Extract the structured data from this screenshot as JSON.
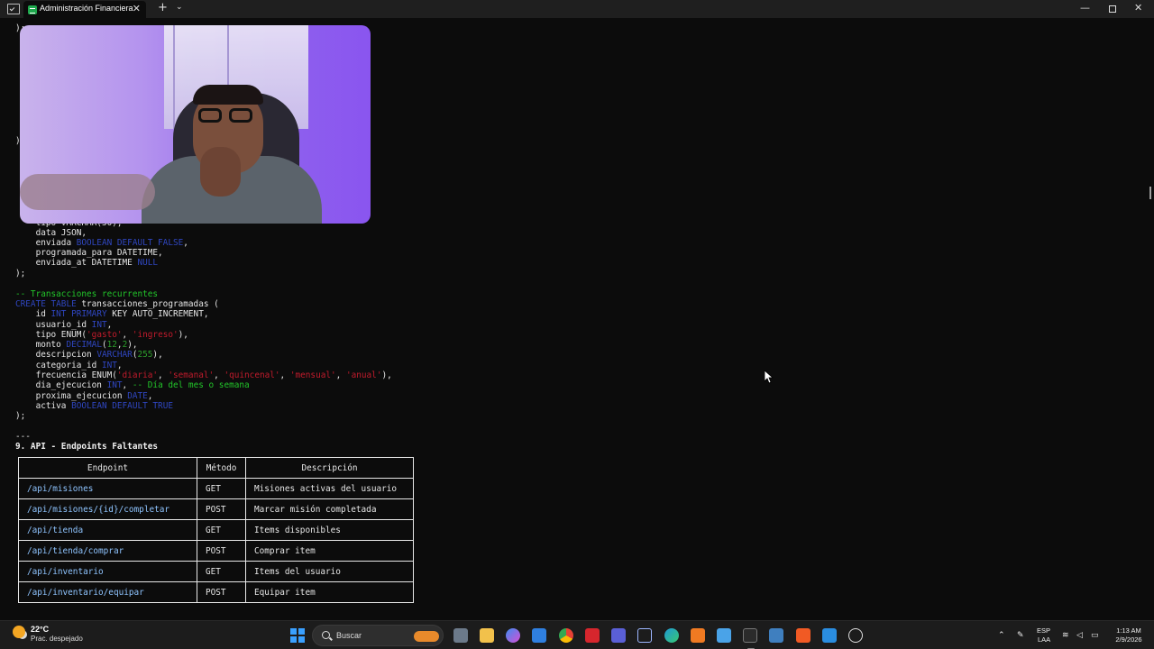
{
  "window": {
    "tab_title": "Administración Financiera",
    "tab_close": "✕",
    "new_tab": "+",
    "tab_menu": "⌄",
    "minimize": "—",
    "close": "✕"
  },
  "terminal": {
    "top_lines": [
      ");",
      ")"
    ],
    "sql_rest_lines": {
      "l1": "    tipo VARCHAR(50),",
      "l2": "    data JSON,",
      "l3a": "    enviada ",
      "l3b": "BOOLEAN DEFAULT FALSE",
      "l3c": ",",
      "l4": "    programada_para DATETIME,",
      "l5a": "    enviada_at DATETIME ",
      "l5b": "NULL",
      "l6": ");"
    },
    "comment_recurrentes": "-- Transacciones recurrentes",
    "create_kw": "CREATE TABLE",
    "table_name": " transacciones_programadas (",
    "id_a": "    id ",
    "id_b": "INT PRIMARY",
    "id_c": " KEY AUTO_INCREMENT,",
    "usuario_a": "    usuario_id ",
    "usuario_b": "INT",
    "usuario_c": ",",
    "tipo_a": "    tipo ENUM(",
    "tipo_s1": "'gasto'",
    "tipo_sep": ", ",
    "tipo_s2": "'ingreso'",
    "tipo_c": "),",
    "monto_a": "    monto ",
    "monto_b": "DECIMAL",
    "monto_c": "(",
    "monto_n1": "12",
    "monto_d": ",",
    "monto_n2": "2",
    "monto_e": "),",
    "desc_a": "    descripcion ",
    "desc_b": "VARCHAR",
    "desc_c": "(",
    "desc_n": "255",
    "desc_d": "),",
    "cat_a": "    categoria_id ",
    "cat_b": "INT",
    "cat_c": ",",
    "frec_a": "    frecuencia ENUM(",
    "frec_s1": "'diaria'",
    "frec_s2": "'semanal'",
    "frec_s3": "'quincenal'",
    "frec_s4": "'mensual'",
    "frec_s5": "'anual'",
    "frec_sep": ", ",
    "frec_c": "),",
    "dia_a": "    dia_ejecucion ",
    "dia_b": "INT",
    "dia_c": ", ",
    "dia_cm": "-- Día del mes o semana",
    "prox_a": "    proxima_ejecucion ",
    "prox_b": "DATE",
    "prox_c": ",",
    "act_a": "    activa ",
    "act_b": "BOOLEAN DEFAULT TRUE",
    "close": ");",
    "hr": "---",
    "section_heading": "9. API - Endpoints Faltantes"
  },
  "table": {
    "headers": [
      "Endpoint",
      "Método",
      "Descripción"
    ],
    "rows": [
      [
        "/api/misiones",
        "GET",
        "Misiones activas del usuario"
      ],
      [
        "/api/misiones/{id}/completar",
        "POST",
        "Marcar misión completada"
      ],
      [
        "/api/tienda",
        "GET",
        "Items disponibles"
      ],
      [
        "/api/tienda/comprar",
        "POST",
        "Comprar item"
      ],
      [
        "/api/inventario",
        "GET",
        "Items del usuario"
      ],
      [
        "/api/inventario/equipar",
        "POST",
        "Equipar item"
      ]
    ]
  },
  "taskbar": {
    "temperature": "22°C",
    "weather": "Prac. despejado",
    "search_placeholder": "Buscar",
    "lang_top": "ESP",
    "lang_bottom": "LAA",
    "time": "1:13 AM",
    "date": "2/9/2026"
  },
  "colors": {
    "keyword": "#2f46c0",
    "comment": "#22c52a",
    "string": "#c21b2c",
    "endpoint": "#8fc4ff"
  }
}
